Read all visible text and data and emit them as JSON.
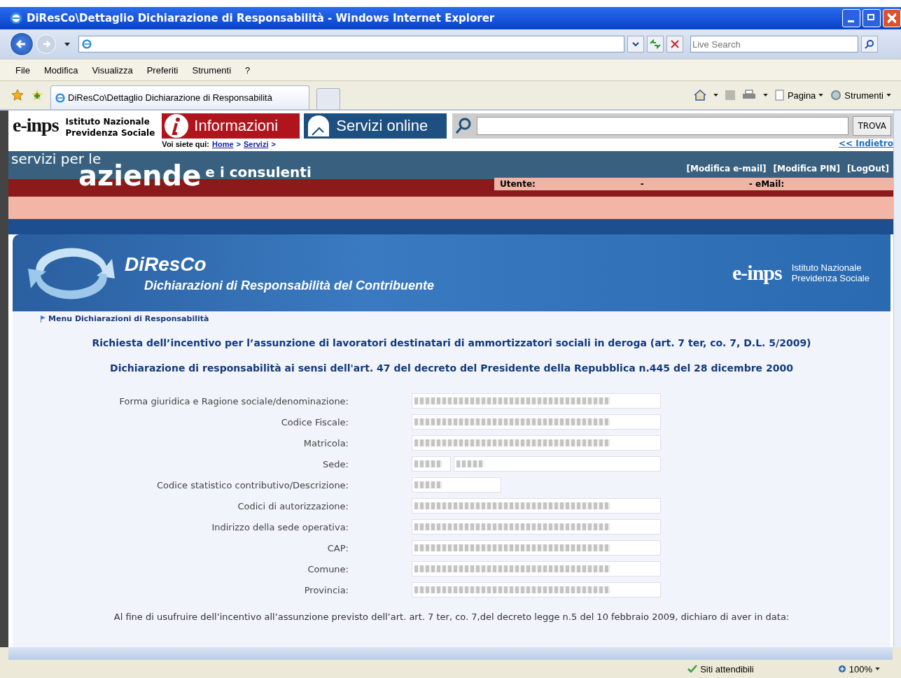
{
  "window": {
    "title": "DiResCo\\Dettaglio Dichiarazione di Responsabilità - Windows Internet Explorer"
  },
  "address_bar": {
    "search_placeholder": "Live Search"
  },
  "menu": [
    "File",
    "Modifica",
    "Visualizza",
    "Preferiti",
    "Strumenti",
    "?"
  ],
  "browser_tabs": [
    {
      "label": "DiResCo\\Dettaglio Dichiarazione di Responsabilità",
      "selected": true
    }
  ],
  "command_bar": {
    "page": "Pagina",
    "tools": "Strumenti"
  },
  "site_header": {
    "logo": "e-inps",
    "org_line_1": "Istituto Nazionale",
    "org_line_2": "Previdenza Sociale",
    "nav_tabs": [
      {
        "label": "Informazioni",
        "kind": "info"
      },
      {
        "label": "Servizi online",
        "kind": "online"
      }
    ],
    "search_button": "TROVA",
    "breadcrumb_prefix": "Voi siete qui:",
    "breadcrumb": [
      "Home",
      "Servizi"
    ],
    "breadcrumb_separator": ">",
    "back_link": "<< Indietro"
  },
  "banner": {
    "line_1": "servizi per le",
    "big": "aziende",
    "line_2": "e i consulenti",
    "links": [
      "[Modifica e-mail]",
      "[Modifica PIN]",
      "[LogOut]"
    ],
    "user_label": "Utente:",
    "dash": "-",
    "email_label": "- eMail:"
  },
  "app_header": {
    "title": "DiResCo",
    "subtitle": "Dichiarazioni di Responsabilità del Contribuente",
    "logo": "e-inps",
    "org_line_1": "Istituto Nazionale",
    "org_line_2": "Previdenza Sociale"
  },
  "menu_link": "Menu Dichiarazioni di Responsabilità",
  "headings": [
    "Richiesta dell’incentivo per l’assunzione di lavoratori destinatari di ammortizzatori sociali in deroga (art. 7 ter, co. 7, D.L. 5/2009)",
    "Dichiarazione di responsabilità ai sensi dell'art. 47 del decreto del Presidente della Repubblica n.445 del 28 dicembre 2000"
  ],
  "form_rows": [
    {
      "label": "Forma giuridica e Ragione sociale/denominazione:",
      "kind": "full"
    },
    {
      "label": "Codice Fiscale:",
      "kind": "full"
    },
    {
      "label": "Matricola:",
      "kind": "full"
    },
    {
      "label": "Sede:",
      "kind": "split"
    },
    {
      "label": "Codice statistico contributivo/Descrizione:",
      "kind": "short"
    },
    {
      "label": "Codici di autorizzazione:",
      "kind": "full"
    },
    {
      "label": "Indirizzo della sede operativa:",
      "kind": "full"
    },
    {
      "label": "CAP:",
      "kind": "full"
    },
    {
      "label": "Comune:",
      "kind": "full"
    },
    {
      "label": "Provincia:",
      "kind": "full"
    }
  ],
  "declaration": "Al fine di usufruire dell’incentivo all’assunzione previsto dell’art. art. 7 ter, co. 7,del decreto legge n.5 del 10 febbraio 2009, dichiaro di aver in data:",
  "status_bar": {
    "zone": "Siti attendibili",
    "zoom": "100%"
  }
}
